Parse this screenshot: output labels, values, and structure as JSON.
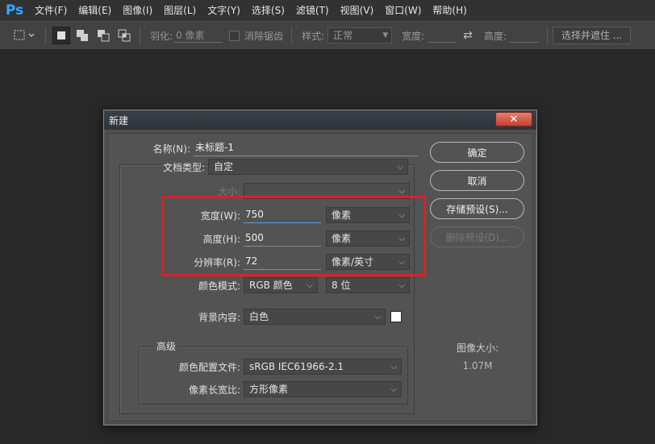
{
  "app": {
    "logo": "Ps",
    "accent": "#31a8ff"
  },
  "menu": [
    {
      "label": "文件(F)"
    },
    {
      "label": "编辑(E)"
    },
    {
      "label": "图像(I)"
    },
    {
      "label": "图层(L)"
    },
    {
      "label": "文字(Y)"
    },
    {
      "label": "选择(S)"
    },
    {
      "label": "滤镜(T)"
    },
    {
      "label": "视图(V)"
    },
    {
      "label": "窗口(W)"
    },
    {
      "label": "帮助(H)"
    }
  ],
  "options": {
    "feather_label": "羽化:",
    "feather_value": "0 像素",
    "antialias_label": "消除锯齿",
    "style_label": "样式:",
    "style_value": "正常",
    "width_label": "宽度:",
    "height_label": "高度:",
    "select_mask_button": "选择并遮住 ..."
  },
  "dialog": {
    "title": "新建",
    "name_label": "名称(N):",
    "name_value": "未标题-1",
    "doc_type_label": "文档类型:",
    "doc_type_value": "自定",
    "size_label": "大小:",
    "size_value": "",
    "width_label": "宽度(W):",
    "width_value": "750",
    "width_unit": "像素",
    "height_label": "高度(H):",
    "height_value": "500",
    "height_unit": "像素",
    "resolution_label": "分辨率(R):",
    "resolution_value": "72",
    "resolution_unit": "像素/英寸",
    "color_mode_label": "颜色模式:",
    "color_mode_value": "RGB 颜色",
    "bit_depth_value": "8 位",
    "background_label": "背景内容:",
    "background_value": "白色",
    "background_swatch": "#ffffff",
    "advanced_title": "高级",
    "color_profile_label": "颜色配置文件:",
    "color_profile_value": "sRGB IEC61966-2.1",
    "pixel_aspect_label": "像素长宽比:",
    "pixel_aspect_value": "方形像素",
    "ok_button": "确定",
    "cancel_button": "取消",
    "save_preset_button": "存储预设(S)...",
    "delete_preset_button": "删除预设(D)...",
    "image_size_label": "图像大小:",
    "image_size_value": "1.07M",
    "close_glyph": "✕",
    "highlight_color": "#e21e22"
  }
}
